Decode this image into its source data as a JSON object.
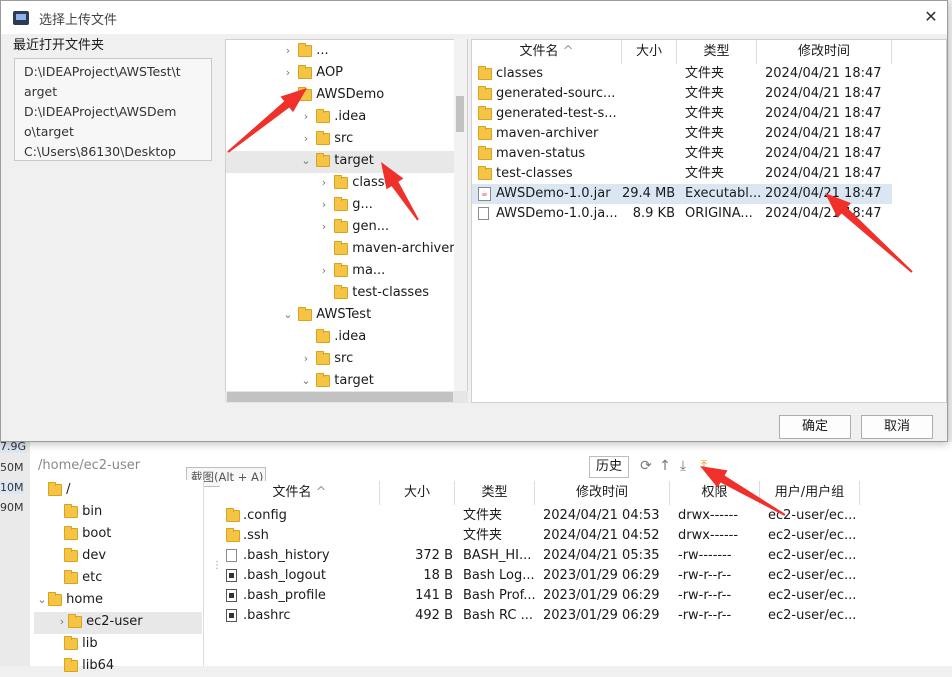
{
  "dialog": {
    "title": "选择上传文件",
    "close_symbol": "✕",
    "recent_label": "最近打开文件夹",
    "recent": [
      "D:\\IDEAProject\\AWSTest\\t",
      "arget",
      "D:\\IDEAProject\\AWSDem",
      "o\\target",
      "C:\\Users\\86130\\Desktop"
    ],
    "tree": [
      {
        "label": "...",
        "indent": 0,
        "chev": "›"
      },
      {
        "label": "AOP",
        "indent": 0,
        "chev": "›"
      },
      {
        "label": "AWSDemo",
        "indent": 0,
        "chev": "⌄"
      },
      {
        "label": ".idea",
        "indent": 1,
        "chev": "›"
      },
      {
        "label": "src",
        "indent": 1,
        "chev": "›"
      },
      {
        "label": "target",
        "indent": 1,
        "chev": "⌄"
      },
      {
        "label": "classes",
        "indent": 2,
        "chev": "›"
      },
      {
        "label": "g...",
        "indent": 2,
        "chev": "›"
      },
      {
        "label": "gen...",
        "indent": 2,
        "chev": "›"
      },
      {
        "label": "maven-archiver",
        "indent": 2,
        "chev": ""
      },
      {
        "label": "ma...",
        "indent": 2,
        "chev": "›"
      },
      {
        "label": "test-classes",
        "indent": 2,
        "chev": ""
      },
      {
        "label": "AWSTest",
        "indent": 0,
        "chev": "⌄"
      },
      {
        "label": ".idea",
        "indent": 1,
        "chev": ""
      },
      {
        "label": "src",
        "indent": 1,
        "chev": "›"
      },
      {
        "label": "target",
        "indent": 1,
        "chev": "⌄"
      }
    ],
    "columns": [
      "文件名",
      "大小",
      "类型",
      "修改时间"
    ],
    "sort_arrow": "^",
    "files": [
      {
        "icon": "folder",
        "name": "classes",
        "size": "",
        "type": "文件夹",
        "mtime": "2024/04/21 18:47"
      },
      {
        "icon": "folder",
        "name": "generated-sourc...",
        "size": "",
        "type": "文件夹",
        "mtime": "2024/04/21 18:47"
      },
      {
        "icon": "folder",
        "name": "generated-test-s...",
        "size": "",
        "type": "文件夹",
        "mtime": "2024/04/21 18:47"
      },
      {
        "icon": "folder",
        "name": "maven-archiver",
        "size": "",
        "type": "文件夹",
        "mtime": "2024/04/21 18:47"
      },
      {
        "icon": "folder",
        "name": "maven-status",
        "size": "",
        "type": "文件夹",
        "mtime": "2024/04/21 18:47"
      },
      {
        "icon": "folder",
        "name": "test-classes",
        "size": "",
        "type": "文件夹",
        "mtime": "2024/04/21 18:47"
      },
      {
        "icon": "jar",
        "name": "AWSDemo-1.0.jar",
        "size": "29.4 MB",
        "type": "Executabl...",
        "mtime": "2024/04/21 18:47"
      },
      {
        "icon": "file",
        "name": "AWSDemo-1.0.ja...",
        "size": "8.9 KB",
        "type": "ORIGINA...",
        "mtime": "2024/04/21 18:47"
      }
    ],
    "ok_label": "确定",
    "cancel_label": "取消"
  },
  "remote": {
    "path": "/home/ec2-user",
    "tooltip": "截图(Alt + A)",
    "history_label": "历史",
    "icons": [
      "refresh-icon",
      "go-up-icon",
      "download-icon",
      "upload-icon"
    ],
    "tree": [
      {
        "label": "/",
        "indent": 0,
        "chev": ""
      },
      {
        "label": "bin",
        "indent": 1,
        "chev": ""
      },
      {
        "label": "boot",
        "indent": 1,
        "chev": ""
      },
      {
        "label": "dev",
        "indent": 1,
        "chev": ""
      },
      {
        "label": "etc",
        "indent": 1,
        "chev": ""
      },
      {
        "label": "home",
        "indent": 0,
        "chev": "⌄"
      },
      {
        "label": "ec2-user",
        "indent": 1,
        "chev": "›"
      },
      {
        "label": "lib",
        "indent": 1,
        "chev": ""
      },
      {
        "label": "lib64",
        "indent": 1,
        "chev": ""
      }
    ],
    "columns": [
      "文件名",
      "大小",
      "类型",
      "修改时间",
      "权限",
      "用户/用户组"
    ],
    "files": [
      {
        "icon": "folder",
        "name": ".config",
        "size": "",
        "type": "文件夹",
        "mtime": "2024/04/21 04:53",
        "perm": "drwx------",
        "owner": "ec2-user/ec..."
      },
      {
        "icon": "folder",
        "name": ".ssh",
        "size": "",
        "type": "文件夹",
        "mtime": "2024/04/21 04:52",
        "perm": "drwx------",
        "owner": "ec2-user/ec..."
      },
      {
        "icon": "file",
        "name": ".bash_history",
        "size": "372 B",
        "type": "BASH_HI...",
        "mtime": "2024/04/21 05:35",
        "perm": "-rw-------",
        "owner": "ec2-user/ec..."
      },
      {
        "icon": "dark",
        "name": ".bash_logout",
        "size": "18 B",
        "type": "Bash Log...",
        "mtime": "2023/01/29 06:29",
        "perm": "-rw-r--r--",
        "owner": "ec2-user/ec..."
      },
      {
        "icon": "dark",
        "name": ".bash_profile",
        "size": "141 B",
        "type": "Bash Prof...",
        "mtime": "2023/01/29 06:29",
        "perm": "-rw-r--r--",
        "owner": "ec2-user/ec..."
      },
      {
        "icon": "dark",
        "name": ".bashrc",
        "size": "492 B",
        "type": "Bash RC ...",
        "mtime": "2023/01/29 06:29",
        "perm": "-rw-r--r--",
        "owner": "ec2-user/ec..."
      }
    ],
    "side_numbers": [
      "7.9G",
      "50M",
      "10M",
      "90M"
    ]
  },
  "colors": {
    "arrow": "#f0302a",
    "selection": "#dbe6f3",
    "folder": "#f6c445"
  }
}
